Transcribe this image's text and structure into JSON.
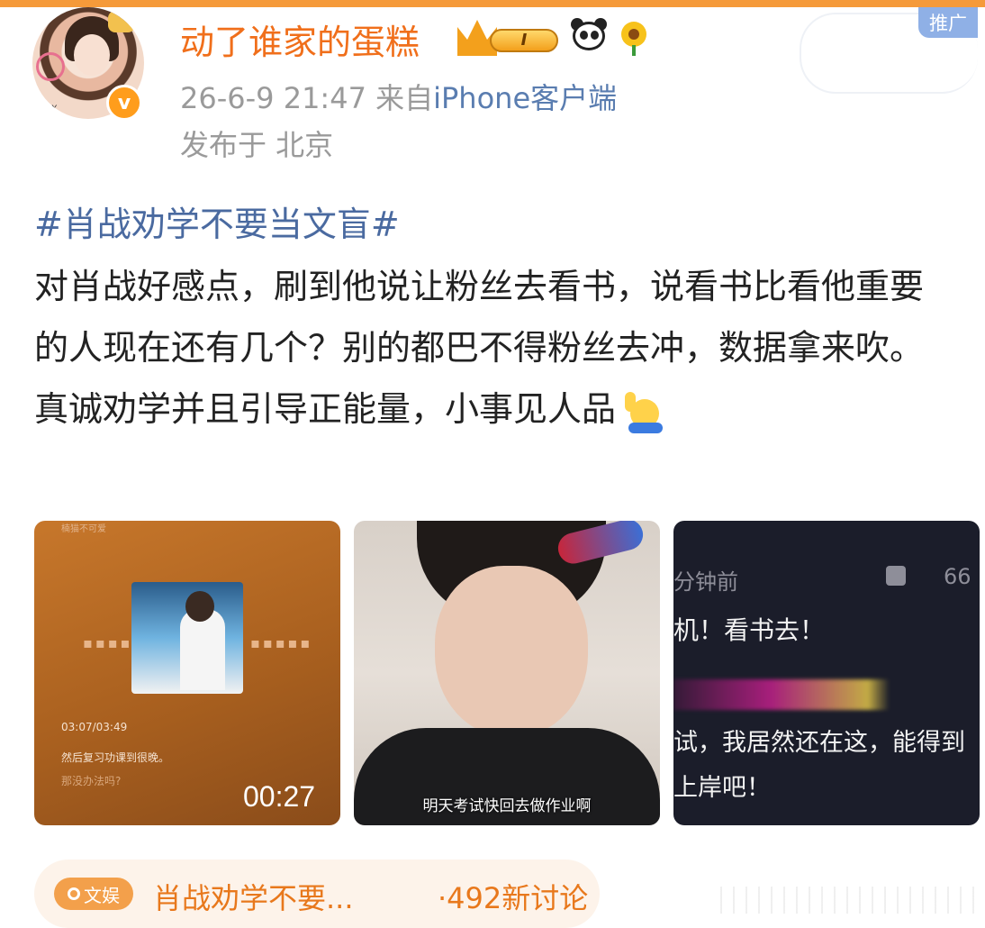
{
  "ad": {
    "label": "推广"
  },
  "post": {
    "username": "动了谁家的蛋糕",
    "vip_level": "I",
    "time": "26-6-9 21:47",
    "source_prefix": "来自",
    "source": "iPhone客户端",
    "location": "发布于 北京",
    "hashtag": "#肖战劝学不要当文盲#",
    "paragraphs": [
      "对肖战好感点，刷到他说让粉丝去看书，说看书比看他重要的人现在还有几个？别的都巴不得粉丝去冲，数据拿来吹。",
      "真诚劝学并且引导正能量，小事见人品"
    ]
  },
  "media": [
    {
      "top_text": "楠猫不可爱",
      "progress": "03:07/03:49",
      "lyric1": "然后复习功课到很晚。",
      "lyric2": "那没办法吗?",
      "duration": "00:27",
      "dots": "▪▪▪▪▪"
    },
    {
      "caption": "明天考试快回去做作业啊"
    },
    {
      "time": "分钟前",
      "count": "66",
      "line1": "机！看书去！",
      "line2": "试，我居然还在这，能得到",
      "line3": "上岸吧！"
    }
  ],
  "topic": {
    "tag": "文娱",
    "text": "肖战劝学不要...",
    "count": "·492新讨论"
  },
  "colors": {
    "accent": "#f06f1b",
    "link": "#4a6aa0",
    "ad_badge": "#8fb0e6"
  },
  "icons": [
    "crown-icon",
    "panda-icon",
    "sunflower-icon",
    "verified-icon",
    "raised-hand-emoji",
    "search-icon",
    "like-icon",
    "rocket-icon"
  ]
}
